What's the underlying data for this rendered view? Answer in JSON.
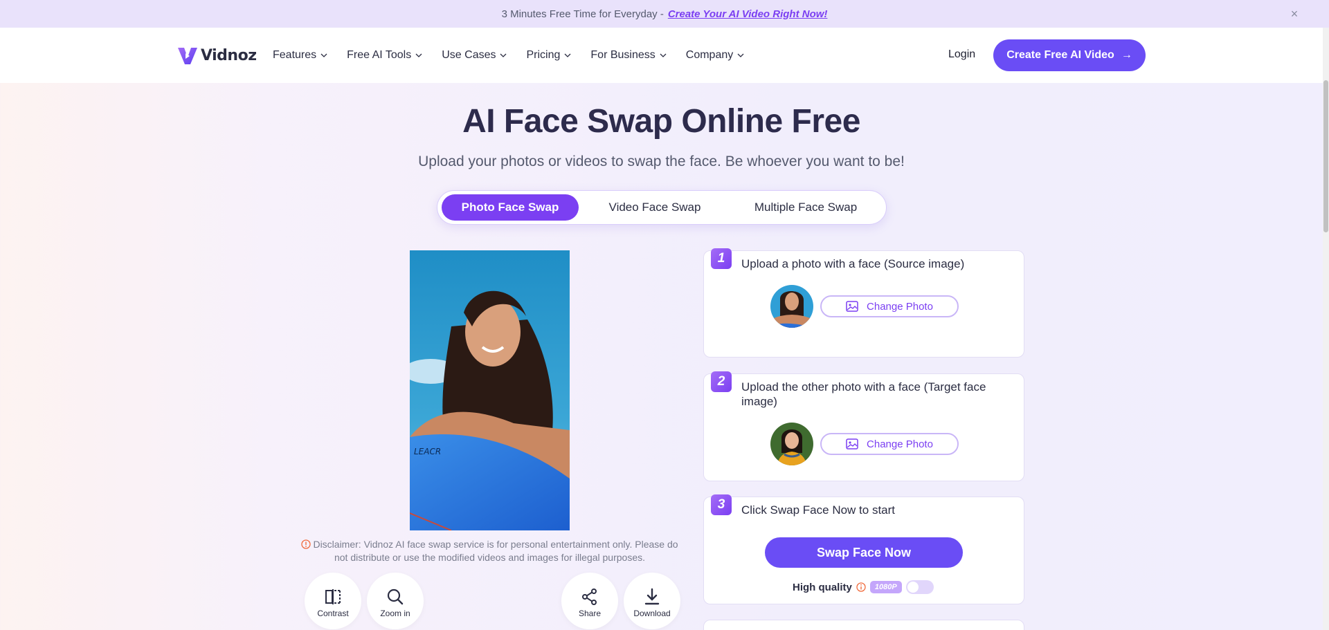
{
  "promo": {
    "text": "3 Minutes Free Time for Everyday - ",
    "link": "Create Your AI Video Right Now!",
    "close": "×"
  },
  "nav": {
    "logo_text": "Vidnoz",
    "menu": [
      {
        "label": "Features"
      },
      {
        "label": "Free AI Tools"
      },
      {
        "label": "Use Cases"
      },
      {
        "label": "Pricing"
      },
      {
        "label": "For Business"
      },
      {
        "label": "Company"
      }
    ],
    "login": "Login",
    "cta": "Create Free AI Video",
    "cta_arrow": "→"
  },
  "hero": {
    "title": "AI Face Swap Online Free",
    "subtitle": "Upload your photos or videos to swap the face. Be whoever you want to be!"
  },
  "tabs": {
    "photo": "Photo Face Swap",
    "video": "Video Face Swap",
    "multiple": "Multiple Face Swap",
    "active": "photo"
  },
  "preview": {
    "board_text": "LEACR"
  },
  "disclaimer": "Disclaimer: Vidnoz AI face swap service is for personal entertainment only. Please do not distribute or use the modified videos and images for illegal purposes.",
  "tools": {
    "contrast": "Contrast",
    "zoom": "Zoom in",
    "share": "Share",
    "download": "Download"
  },
  "steps": [
    {
      "num": "1",
      "text": "Upload a photo with a face (Source image)",
      "button": "Change Photo"
    },
    {
      "num": "2",
      "text": "Upload the other photo with a face (Target face image)",
      "button": "Change Photo"
    },
    {
      "num": "3",
      "text": "Click Swap Face Now to start",
      "button": "Swap Face Now"
    }
  ],
  "quality": {
    "label": "High quality",
    "badge": "1080P",
    "enabled": false
  },
  "colors": {
    "accent": "#7b3ff2",
    "cta": "#6a4df5",
    "heading": "#2d2b4c"
  }
}
